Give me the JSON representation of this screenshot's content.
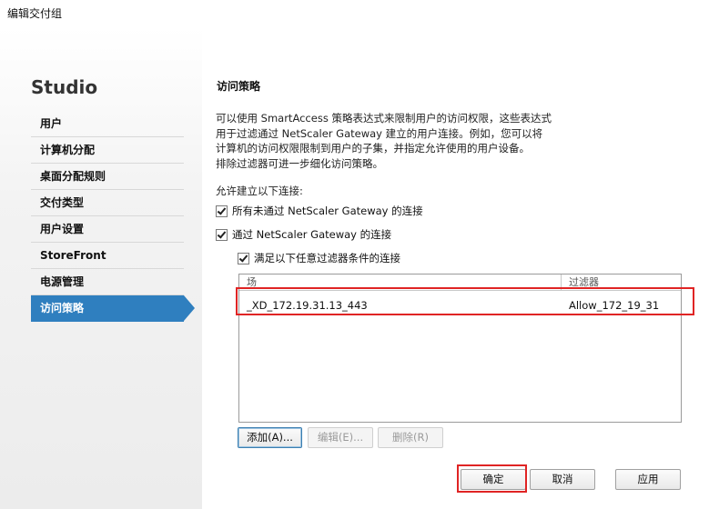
{
  "window": {
    "title": "编辑交付组"
  },
  "sidebar": {
    "brand": "Studio",
    "items": [
      {
        "label": "用户"
      },
      {
        "label": "计算机分配"
      },
      {
        "label": "桌面分配规则"
      },
      {
        "label": "交付类型"
      },
      {
        "label": "用户设置"
      },
      {
        "label": "StoreFront"
      },
      {
        "label": "电源管理"
      },
      {
        "label": "访问策略",
        "active": true
      }
    ]
  },
  "main": {
    "heading": "访问策略",
    "description": [
      "可以使用 SmartAccess 策略表达式来限制用户的访问权限，这些表达式",
      "用于过滤通过 NetScaler Gateway 建立的用户连接。例如，您可以将",
      "计算机的访问权限限制到用户的子集，并指定允许使用的用户设备。",
      "排除过滤器可进一步细化访问策略。"
    ],
    "allow_label": "允许建立以下连接:",
    "checkbox_non_gateway": {
      "label": "所有未通过 NetScaler Gateway 的连接",
      "checked": true
    },
    "checkbox_gateway": {
      "label": "通过 NetScaler Gateway 的连接",
      "checked": true
    },
    "checkbox_filter": {
      "label": "满足以下任意过滤器条件的连接",
      "checked": true
    },
    "table": {
      "columns": [
        "场",
        "过滤器"
      ],
      "rows": [
        {
          "farm": "_XD_172.19.31.13_443",
          "filter": "Allow_172_19_31"
        }
      ]
    },
    "table_buttons": {
      "add": "添加(A)...",
      "edit": "编辑(E)...",
      "delete": "删除(R)"
    }
  },
  "footer": {
    "ok": "确定",
    "cancel": "取消",
    "apply": "应用"
  },
  "colors": {
    "accent": "#2f7fbf",
    "highlight": "#e02424"
  }
}
